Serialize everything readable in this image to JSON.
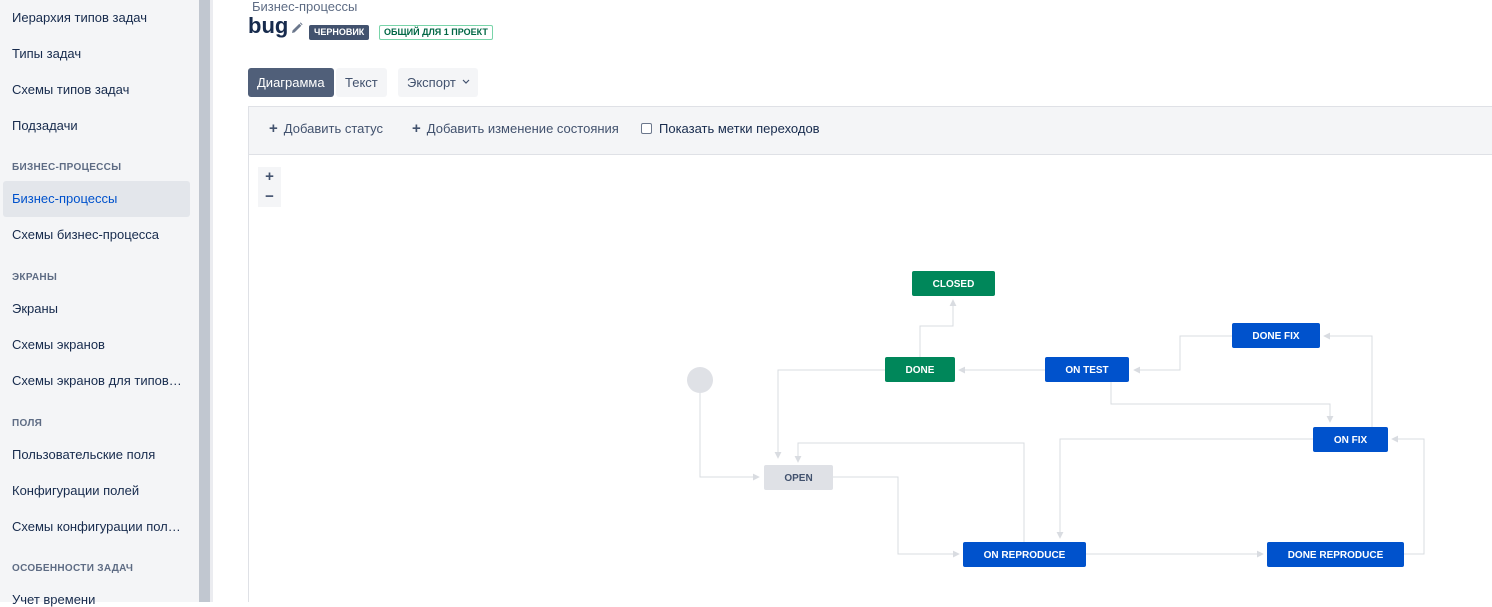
{
  "sidebar": {
    "items": [
      {
        "label": "Иерархия типов задач"
      },
      {
        "label": "Типы задач"
      },
      {
        "label": "Схемы типов задач"
      },
      {
        "label": "Подзадачи"
      }
    ],
    "section_workflows": "БИЗНЕС-ПРОЦЕССЫ",
    "workflows_items": [
      {
        "label": "Бизнес-процессы",
        "active": true
      },
      {
        "label": "Схемы бизнес-процесса"
      }
    ],
    "section_screens": "ЭКРАНЫ",
    "screens_items": [
      {
        "label": "Экраны"
      },
      {
        "label": "Схемы экранов"
      },
      {
        "label": "Схемы экранов для типов…"
      }
    ],
    "section_fields": "ПОЛЯ",
    "fields_items": [
      {
        "label": "Пользовательские поля"
      },
      {
        "label": "Конфигурации полей"
      },
      {
        "label": "Схемы конфигурации пол…"
      }
    ],
    "section_features": "ОСОБЕННОСТИ ЗАДАЧ",
    "features_items": [
      {
        "label": "Учет времени"
      }
    ]
  },
  "header": {
    "breadcrumb": "Бизнес-процессы",
    "title": "bug",
    "draft_badge": "ЧЕРНОВИК",
    "shared_badge": "ОБЩИЙ ДЛЯ 1 ПРОЕКТ"
  },
  "tabs": {
    "diagram": "Диаграмма",
    "text": "Текст",
    "export": "Экспорт"
  },
  "toolbar": {
    "add_status": "Добавить статус",
    "add_transition": "Добавить изменение состояния",
    "show_labels": "Показать метки переходов",
    "show_labels_checked": false
  },
  "zoom": {
    "in": "+",
    "out": "−"
  },
  "diagram": {
    "colors": {
      "done": "#00875a",
      "in_progress": "#0052cc",
      "todo": "#dfe1e6",
      "line": "#d9dce1"
    },
    "statuses": [
      {
        "id": "closed",
        "label": "CLOSED",
        "category": "done"
      },
      {
        "id": "done",
        "label": "DONE",
        "category": "done"
      },
      {
        "id": "on_test",
        "label": "ON TEST",
        "category": "in_progress"
      },
      {
        "id": "done_fix",
        "label": "DONE FIX",
        "category": "in_progress"
      },
      {
        "id": "on_fix",
        "label": "ON FIX",
        "category": "in_progress"
      },
      {
        "id": "open",
        "label": "OPEN",
        "category": "todo"
      },
      {
        "id": "on_reproduce",
        "label": "ON REPRODUCE",
        "category": "in_progress"
      },
      {
        "id": "done_reproduce",
        "label": "DONE REPRODUCE",
        "category": "in_progress"
      }
    ],
    "transitions": [
      {
        "from": "start",
        "to": "open"
      },
      {
        "from": "open",
        "to": "on_reproduce"
      },
      {
        "from": "on_reproduce",
        "to": "open"
      },
      {
        "from": "on_reproduce",
        "to": "done_reproduce"
      },
      {
        "from": "done_reproduce",
        "to": "on_fix"
      },
      {
        "from": "on_fix",
        "to": "done_fix"
      },
      {
        "from": "on_fix",
        "to": "on_reproduce"
      },
      {
        "from": "done_fix",
        "to": "on_test"
      },
      {
        "from": "on_test",
        "to": "on_fix"
      },
      {
        "from": "on_test",
        "to": "done"
      },
      {
        "from": "done",
        "to": "closed"
      },
      {
        "from": "done",
        "to": "open"
      }
    ]
  }
}
